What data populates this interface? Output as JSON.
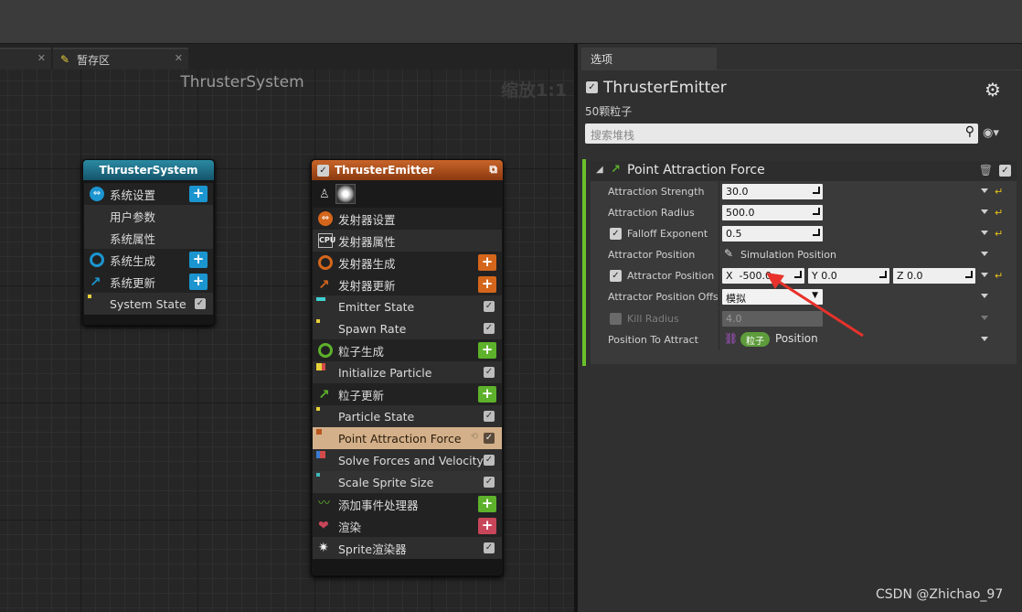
{
  "tabs": [
    {
      "label": ""
    },
    {
      "label": "暂存区"
    }
  ],
  "graph": {
    "title": "ThrusterSystem",
    "zoom": "缩放1:1"
  },
  "system_node": {
    "title": "ThrusterSystem",
    "header_color": "#1f7a94",
    "rows": [
      {
        "label": "系统设置",
        "add": true,
        "icon": "system-settings-icon"
      },
      {
        "label": "用户参数"
      },
      {
        "label": "系统属性"
      },
      {
        "label": "系统生成",
        "add": true,
        "icon": "spawn-ring-icon"
      },
      {
        "label": "系统更新",
        "add": true,
        "icon": "update-arrow-icon"
      },
      {
        "label": "System State",
        "check": true
      }
    ]
  },
  "emitter_node": {
    "title": "ThrusterEmitter",
    "header_color": "#b9571e",
    "rows": [
      {
        "label": "发射器设置",
        "icon": "emitter-settings-icon"
      },
      {
        "label": "发射器属性",
        "icon": "cpu-icon"
      },
      {
        "label": "发射器生成",
        "add": true,
        "icon": "spawn-ring-icon"
      },
      {
        "label": "发射器更新",
        "add": true,
        "icon": "update-arrow-icon"
      },
      {
        "label": "Emitter State",
        "check": true
      },
      {
        "label": "Spawn Rate",
        "check": true
      },
      {
        "label": "粒子生成",
        "add": true,
        "icon": "particle-spawn-icon"
      },
      {
        "label": "Initialize Particle",
        "check": true
      },
      {
        "label": "粒子更新",
        "add": true,
        "icon": "particle-update-icon"
      },
      {
        "label": "Particle State",
        "check": true
      },
      {
        "label": "Point Attraction Force",
        "check": true,
        "selected": true
      },
      {
        "label": "Solve Forces and Velocity",
        "check": true
      },
      {
        "label": "Scale Sprite Size",
        "check": true
      },
      {
        "label": "添加事件处理器",
        "add": true,
        "icon": "event-handler-icon"
      },
      {
        "label": "渲染",
        "add": true,
        "icon": "render-icon"
      },
      {
        "label": "Sprite渲染器",
        "check": true,
        "icon": "sprite-icon"
      }
    ]
  },
  "details": {
    "tab": "选项",
    "title": "ThrusterEmitter",
    "subtitle": "50颗粒子",
    "search_placeholder": "搜索堆栈",
    "section_title": "Point Attraction Force",
    "props": [
      {
        "label": "Attraction Strength",
        "value": "30.0"
      },
      {
        "label": "Attraction Radius",
        "value": "500.0"
      },
      {
        "label": "Falloff Exponent",
        "value": "0.5",
        "checkbox": true
      },
      {
        "label": "Attractor Position",
        "value": "Simulation Position"
      },
      {
        "label": "Attractor Position (",
        "checkbox": true,
        "x": "-500.0",
        "y": "0.0",
        "z": "0.0"
      },
      {
        "label": "Attractor Position Offse",
        "value": "模拟"
      },
      {
        "label": "Kill Radius",
        "value": "4.0",
        "checkbox": true,
        "disabled": true
      },
      {
        "label": "Position To Attract",
        "tag": "粒子",
        "value": "Position"
      }
    ],
    "axis_labels": {
      "x": "X",
      "y": "Y",
      "z": "Z"
    }
  },
  "colors": {
    "accent_green": "#6ac22b",
    "add_blue": "#1b95d0",
    "add_orange": "#d4661c",
    "add_green": "#5db12b",
    "add_red": "#c8465a",
    "annotation_arrow": "#e8322b"
  },
  "watermark": "CSDN @Zhichao_97"
}
